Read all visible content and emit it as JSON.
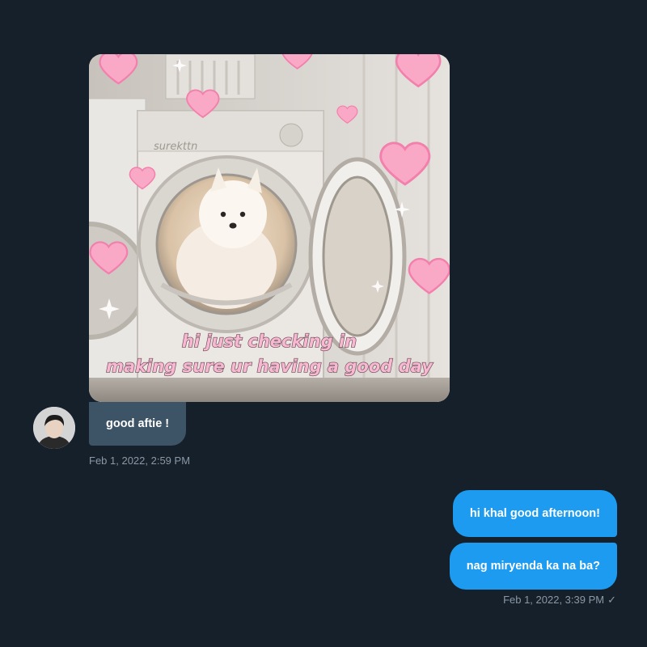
{
  "conversation": {
    "received": {
      "media_caption_line1": "hi just checking in",
      "media_caption_line2": "making sure ur having a good day",
      "media_brand_text": "surekttn",
      "message": "good aftie !",
      "timestamp": "Feb 1, 2022, 2:59 PM",
      "bubble_color": "#3d5466"
    },
    "sent": {
      "messages": [
        "hi khal good afternoon!",
        "nag miryenda ka na ba?"
      ],
      "timestamp": "Feb 1, 2022, 3:39 PM",
      "status_icon": "check-icon",
      "status_glyph": "✓",
      "bubble_color": "#1d9bf0"
    }
  },
  "theme": {
    "background": "#15202b",
    "timestamp_color": "#8b98a5",
    "heart_color": "#f9a9c6"
  }
}
